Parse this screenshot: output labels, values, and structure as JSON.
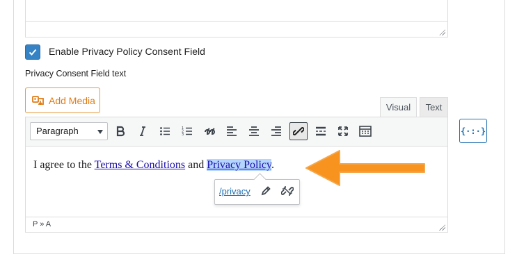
{
  "consent": {
    "checkbox_label": "Enable Privacy Policy Consent Field",
    "checked": true,
    "field_label": "Privacy Consent Field text"
  },
  "editor": {
    "add_media_label": "Add Media",
    "tabs": [
      {
        "label": "Visual",
        "active": true
      },
      {
        "label": "Text",
        "active": false
      }
    ],
    "format_select": "Paragraph",
    "toolbar_icons": [
      "bold-icon",
      "italic-icon",
      "bulleted-list-icon",
      "numbered-list-icon",
      "blockquote-icon",
      "align-left-icon",
      "align-center-icon",
      "align-right-icon",
      "link-icon",
      "read-more-icon",
      "fullscreen-icon",
      "toolbar-toggle-icon"
    ],
    "content": {
      "text_before": "I agree to the ",
      "link1": "Terms & Conditions",
      "text_middle": " and ",
      "link2": "Privacy Policy",
      "text_after": "."
    },
    "link_popover": {
      "url": "/privacy",
      "edit_icon": "pencil-icon",
      "remove_icon": "unlink-icon"
    },
    "status_path": "P » A"
  },
  "shortcode_button": "{·:·}",
  "colors": {
    "accent_orange": "#e07b14",
    "checkbox_blue": "#3582c4",
    "link_blue": "#2271b1",
    "selection": "#b4d5fe",
    "arrow_orange": "#f7931e"
  }
}
